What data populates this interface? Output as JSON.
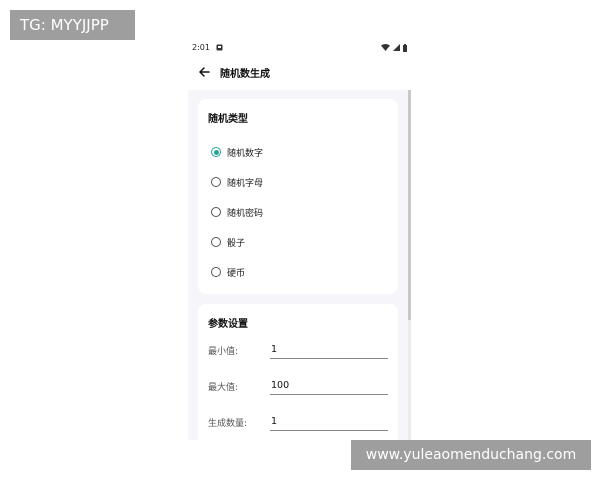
{
  "watermark": {
    "top": "TG: MYYJJPP",
    "bottom": "www.yuleaomenduchang.com"
  },
  "statusbar": {
    "time": "2:01",
    "icons": [
      "notification-icon",
      "wifi-icon",
      "signal-icon",
      "battery-icon"
    ]
  },
  "appbar": {
    "title": "随机数生成",
    "back_icon": "back-arrow-icon"
  },
  "random_type": {
    "title": "随机类型",
    "options": [
      {
        "label": "随机数字",
        "checked": true
      },
      {
        "label": "随机字母",
        "checked": false
      },
      {
        "label": "随机密码",
        "checked": false
      },
      {
        "label": "骰子",
        "checked": false
      },
      {
        "label": "硬币",
        "checked": false
      }
    ]
  },
  "params": {
    "title": "参数设置",
    "fields": [
      {
        "label": "最小值:",
        "value": "1"
      },
      {
        "label": "最大值:",
        "value": "100"
      },
      {
        "label": "生成数量:",
        "value": "1"
      }
    ]
  },
  "colors": {
    "accent": "#26a69a",
    "background": "#f5f5fa",
    "card": "#ffffff"
  }
}
